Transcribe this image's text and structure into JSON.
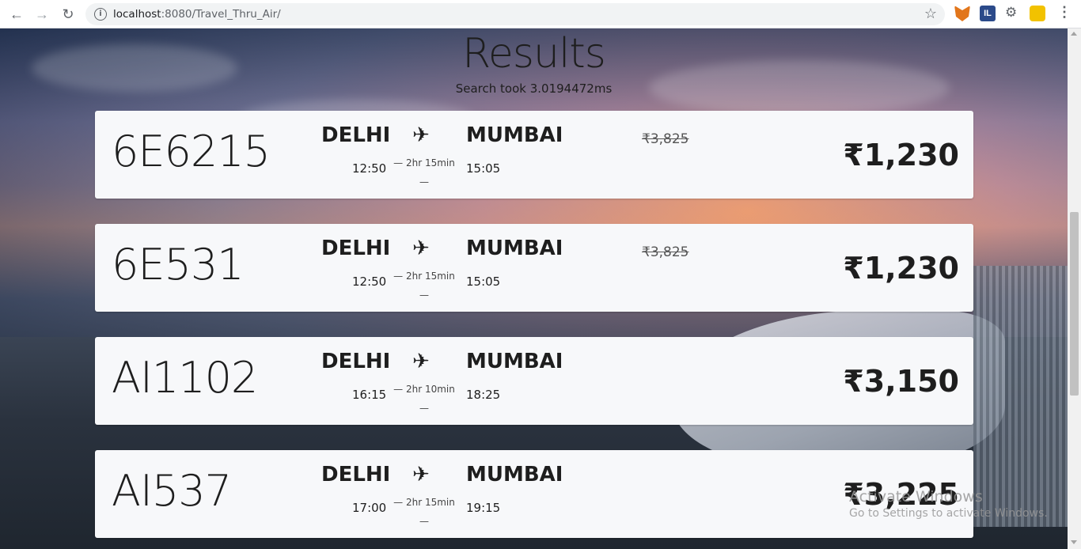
{
  "browser": {
    "url_host": "localhost",
    "url_path": ":8080/Travel_Thru_Air/"
  },
  "page": {
    "title": "Results",
    "search_time": "Search took 3.0194472ms"
  },
  "flights": [
    {
      "flight_no": "6E6215",
      "from": "DELHI",
      "to": "MUMBAI",
      "dep_time": "12:50",
      "arr_time": "15:05",
      "duration_top": "— 2hr 15min",
      "duration_bottom": "—",
      "old_price": "₹3,825",
      "price": "₹1,230"
    },
    {
      "flight_no": "6E531",
      "from": "DELHI",
      "to": "MUMBAI",
      "dep_time": "12:50",
      "arr_time": "15:05",
      "duration_top": "— 2hr 15min",
      "duration_bottom": "—",
      "old_price": "₹3,825",
      "price": "₹1,230"
    },
    {
      "flight_no": "AI1102",
      "from": "DELHI",
      "to": "MUMBAI",
      "dep_time": "16:15",
      "arr_time": "18:25",
      "duration_top": "— 2hr 10min",
      "duration_bottom": "—",
      "old_price": "",
      "price": "₹3,150"
    },
    {
      "flight_no": "AI537",
      "from": "DELHI",
      "to": "MUMBAI",
      "dep_time": "17:00",
      "arr_time": "19:15",
      "duration_top": "— 2hr 15min",
      "duration_bottom": "—",
      "old_price": "",
      "price": "₹3,225"
    }
  ],
  "plane_glyph": "✈",
  "watermark": {
    "line1": "Activate Windows",
    "line2": "Go to Settings to activate Windows."
  },
  "icons": [
    "back-arrow-icon",
    "forward-arrow-icon",
    "reload-icon",
    "info-icon",
    "star-icon",
    "metamask-extension-icon",
    "it-extension-icon",
    "puzzle-icon",
    "profile-avatar-icon",
    "kebab-menu-icon",
    "plane-icon"
  ],
  "colors": {
    "card_bg": "#f7f8fa",
    "text": "#1e1e1e"
  }
}
